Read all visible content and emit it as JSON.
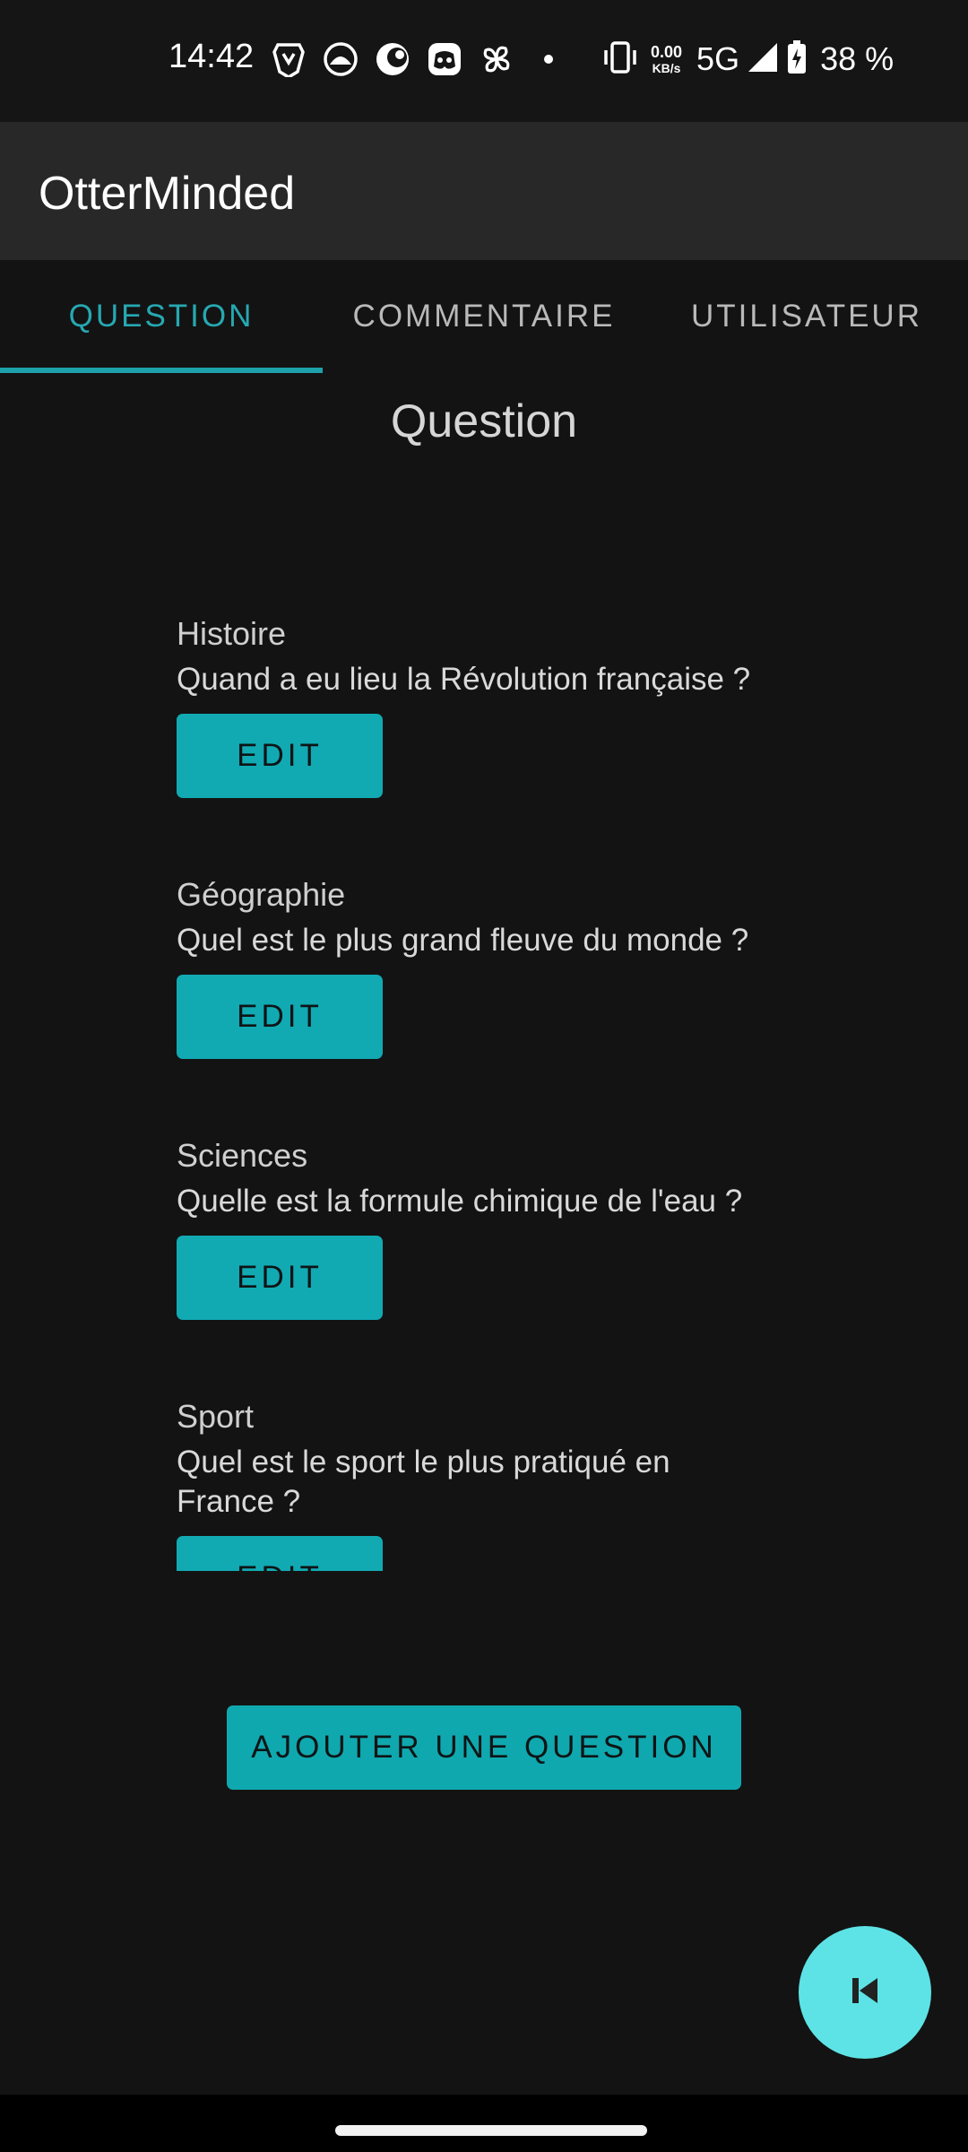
{
  "status_bar": {
    "time": "14:42",
    "net_speed_value": "0.00",
    "net_speed_unit": "KB/s",
    "network_type": "5G",
    "battery_percent": "38 %",
    "notification_icons": [
      "brave-icon",
      "otter-icon",
      "crunchyroll-icon",
      "discord-icon",
      "pinwheel-icon",
      "dot-icon"
    ]
  },
  "app_bar": {
    "title": "OtterMinded"
  },
  "tabs": [
    {
      "label": "QUESTION",
      "active": true
    },
    {
      "label": "COMMENTAIRE",
      "active": false
    },
    {
      "label": "UTILISATEUR",
      "active": false
    }
  ],
  "section": {
    "title": "Question"
  },
  "questions": [
    {
      "category": "Histoire",
      "text": "Quand a eu lieu la Révolution française ?",
      "button_label": "EDIT"
    },
    {
      "category": "Géographie",
      "text": "Quel est le plus grand fleuve du monde ?",
      "button_label": "EDIT"
    },
    {
      "category": "Sciences",
      "text": "Quelle est la formule chimique de l'eau ?",
      "button_label": "EDIT"
    },
    {
      "category": "Sport",
      "text": "Quel est le sport le plus pratiqué en France ?",
      "button_label": "EDIT"
    }
  ],
  "add_button": {
    "label": "AJOUTER UNE QUESTION"
  },
  "fab": {
    "icon": "skip-previous-icon"
  },
  "colors": {
    "accent": "#11aab3",
    "fab": "#5de3e5",
    "background": "#131313",
    "app_bar": "#282828"
  }
}
